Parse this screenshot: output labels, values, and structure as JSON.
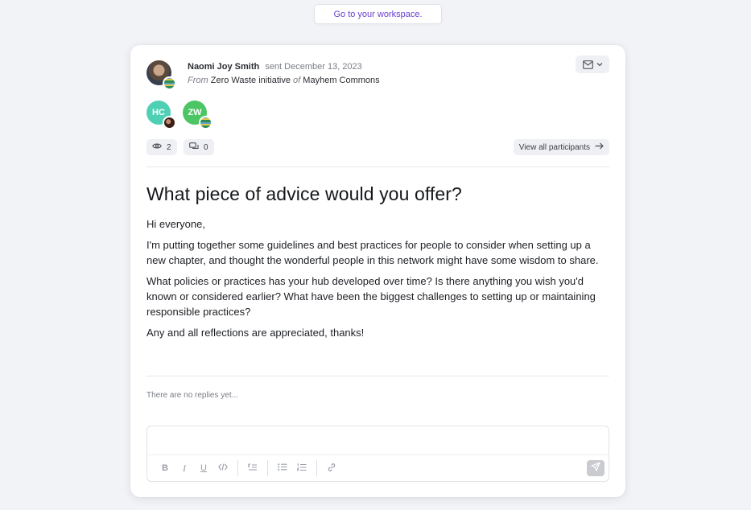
{
  "workspace_link": "Go to your workspace.",
  "message": {
    "sender_name": "Naomi Joy Smith",
    "sent_text": "sent December 13, 2023",
    "from_label": "From",
    "group": "Zero Waste initiative",
    "of_label": "of",
    "hub": "Mayhem Commons",
    "title": "What piece of advice would you offer?",
    "paragraphs": [
      "Hi everyone,",
      "I'm putting together some guidelines and best practices for people to consider when setting up a new chapter, and thought the wonderful people in this network might have some wisdom to share.",
      "What policies or practices has your hub developed over time? Is there anything you wish you'd known or considered earlier? What have been the biggest challenges to setting up or maintaining responsible practices?",
      "Any and all reflections are appreciated, thanks!"
    ]
  },
  "participants": [
    {
      "initials": "HC",
      "color": "#4fd0b5"
    },
    {
      "initials": "ZW",
      "color": "#4cc664"
    }
  ],
  "stats": {
    "views": "2",
    "replies": "0"
  },
  "view_all_label": "View all participants",
  "no_replies_text": "There are no replies yet...",
  "icons": {
    "mail": "mail-icon",
    "chevron": "chevron-down-icon",
    "eye": "eye-icon",
    "comment": "comment-icon",
    "arrow": "arrow-right-icon",
    "send": "send-icon"
  },
  "toolbar": {
    "bold": "B",
    "italic": "I",
    "underline": "U"
  }
}
